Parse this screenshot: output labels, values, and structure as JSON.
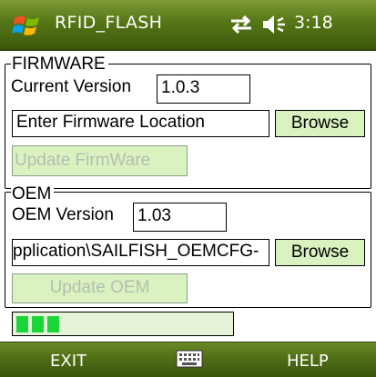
{
  "titlebar": {
    "app_title": "RFID_FLASH",
    "clock": "3:18",
    "icons": [
      "windows-start-icon",
      "connectivity-icon",
      "volume-icon"
    ]
  },
  "firmware": {
    "group_label": "FIRMWARE",
    "current_version_label": "Current Version",
    "current_version_value": "1.0.3",
    "location_value": "Enter Firmware Location",
    "browse_label": "Browse",
    "update_label": "Update FirmWare"
  },
  "oem": {
    "group_label": "OEM",
    "version_label": "OEM Version",
    "version_value": "1.03",
    "path_value": "pplication\\SAILFISH_OEMCFG-",
    "browse_label": "Browse",
    "update_label": "Update OEM"
  },
  "progress": {
    "filled_segments": 3,
    "fraction": 0.2
  },
  "softkeys": {
    "left": "EXIT",
    "right": "HELP",
    "center_icon": "keyboard-icon"
  },
  "colors": {
    "bar_green": "#557616",
    "button_bg": "#d9f2c0",
    "progress_fill": "#1ad53a"
  }
}
